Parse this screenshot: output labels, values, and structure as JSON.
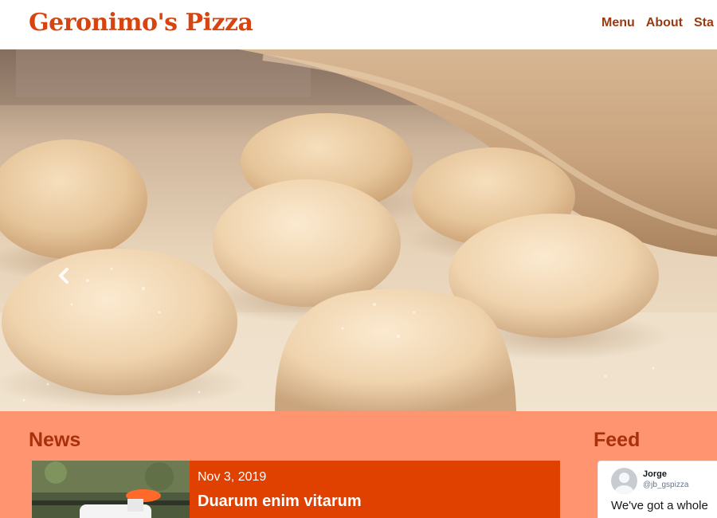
{
  "header": {
    "brand": "Geronimo's Pizza",
    "nav": [
      {
        "label": "Menu"
      },
      {
        "label": "About"
      },
      {
        "label": "Sta"
      }
    ]
  },
  "carousel": {
    "image": "pizza-dough-balls-photo",
    "prev_icon": "chevron-left-icon",
    "slide_count": 3,
    "active_slide": 2
  },
  "news": {
    "heading": "News",
    "items": [
      {
        "date": "Nov 3, 2019",
        "title": "Duarum enim vitarum"
      }
    ]
  },
  "feed": {
    "heading": "Feed",
    "post": {
      "name": "Jorge",
      "handle": "@jb_gspizza",
      "text": "We've got a whole"
    }
  },
  "colors": {
    "brand": "#d64510",
    "nav": "#9b3a12",
    "section_bg": "#ff9470",
    "heading": "#a8310b",
    "card_bg": "#e04000"
  }
}
